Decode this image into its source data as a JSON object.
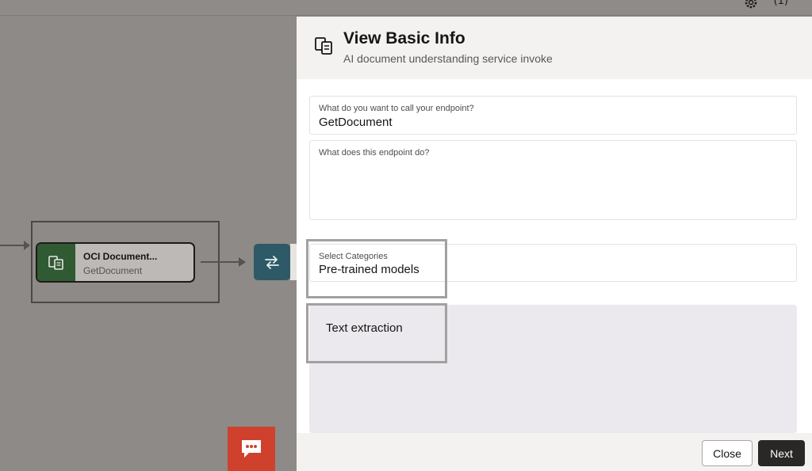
{
  "canvas": {
    "node": {
      "title": "OCI Document...",
      "subtitle": "GetDocument",
      "icon": "document-understanding-icon",
      "color": "#2f5a32"
    },
    "map_node": {
      "icon": "swap-arrows-icon",
      "color": "#2e5966"
    },
    "chat_button": {
      "icon": "chat-icon",
      "color": "#d0412d"
    }
  },
  "topbar": {
    "misc_text": "(1)",
    "icon": "gear-icon"
  },
  "drawer": {
    "title": "View Basic Info",
    "subtitle": "AI document understanding service invoke",
    "icon": "document-understanding-icon",
    "endpoint_name": {
      "label": "What do you want to call your endpoint?",
      "value": "GetDocument"
    },
    "endpoint_description": {
      "label": "What does this endpoint do?",
      "value": ""
    },
    "categories": {
      "label": "Select Categories",
      "value": "Pre-trained models"
    },
    "category_items": [
      "Text extraction"
    ],
    "footer": {
      "close_label": "Close",
      "next_label": "Next"
    }
  }
}
